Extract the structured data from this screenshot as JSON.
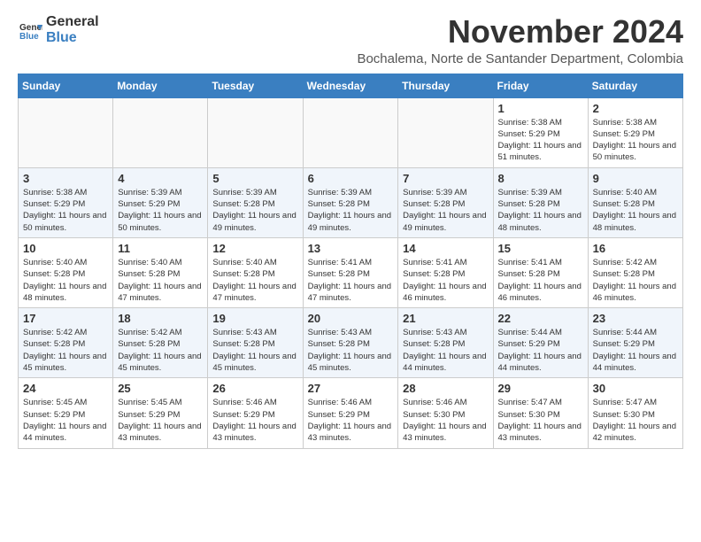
{
  "logo": {
    "general": "General",
    "blue": "Blue"
  },
  "header": {
    "title": "November 2024",
    "subtitle": "Bochalema, Norte de Santander Department, Colombia"
  },
  "columns": [
    "Sunday",
    "Monday",
    "Tuesday",
    "Wednesday",
    "Thursday",
    "Friday",
    "Saturday"
  ],
  "weeks": [
    [
      {
        "day": "",
        "info": ""
      },
      {
        "day": "",
        "info": ""
      },
      {
        "day": "",
        "info": ""
      },
      {
        "day": "",
        "info": ""
      },
      {
        "day": "",
        "info": ""
      },
      {
        "day": "1",
        "info": "Sunrise: 5:38 AM\nSunset: 5:29 PM\nDaylight: 11 hours and 51 minutes."
      },
      {
        "day": "2",
        "info": "Sunrise: 5:38 AM\nSunset: 5:29 PM\nDaylight: 11 hours and 50 minutes."
      }
    ],
    [
      {
        "day": "3",
        "info": "Sunrise: 5:38 AM\nSunset: 5:29 PM\nDaylight: 11 hours and 50 minutes."
      },
      {
        "day": "4",
        "info": "Sunrise: 5:39 AM\nSunset: 5:29 PM\nDaylight: 11 hours and 50 minutes."
      },
      {
        "day": "5",
        "info": "Sunrise: 5:39 AM\nSunset: 5:28 PM\nDaylight: 11 hours and 49 minutes."
      },
      {
        "day": "6",
        "info": "Sunrise: 5:39 AM\nSunset: 5:28 PM\nDaylight: 11 hours and 49 minutes."
      },
      {
        "day": "7",
        "info": "Sunrise: 5:39 AM\nSunset: 5:28 PM\nDaylight: 11 hours and 49 minutes."
      },
      {
        "day": "8",
        "info": "Sunrise: 5:39 AM\nSunset: 5:28 PM\nDaylight: 11 hours and 48 minutes."
      },
      {
        "day": "9",
        "info": "Sunrise: 5:40 AM\nSunset: 5:28 PM\nDaylight: 11 hours and 48 minutes."
      }
    ],
    [
      {
        "day": "10",
        "info": "Sunrise: 5:40 AM\nSunset: 5:28 PM\nDaylight: 11 hours and 48 minutes."
      },
      {
        "day": "11",
        "info": "Sunrise: 5:40 AM\nSunset: 5:28 PM\nDaylight: 11 hours and 47 minutes."
      },
      {
        "day": "12",
        "info": "Sunrise: 5:40 AM\nSunset: 5:28 PM\nDaylight: 11 hours and 47 minutes."
      },
      {
        "day": "13",
        "info": "Sunrise: 5:41 AM\nSunset: 5:28 PM\nDaylight: 11 hours and 47 minutes."
      },
      {
        "day": "14",
        "info": "Sunrise: 5:41 AM\nSunset: 5:28 PM\nDaylight: 11 hours and 46 minutes."
      },
      {
        "day": "15",
        "info": "Sunrise: 5:41 AM\nSunset: 5:28 PM\nDaylight: 11 hours and 46 minutes."
      },
      {
        "day": "16",
        "info": "Sunrise: 5:42 AM\nSunset: 5:28 PM\nDaylight: 11 hours and 46 minutes."
      }
    ],
    [
      {
        "day": "17",
        "info": "Sunrise: 5:42 AM\nSunset: 5:28 PM\nDaylight: 11 hours and 45 minutes."
      },
      {
        "day": "18",
        "info": "Sunrise: 5:42 AM\nSunset: 5:28 PM\nDaylight: 11 hours and 45 minutes."
      },
      {
        "day": "19",
        "info": "Sunrise: 5:43 AM\nSunset: 5:28 PM\nDaylight: 11 hours and 45 minutes."
      },
      {
        "day": "20",
        "info": "Sunrise: 5:43 AM\nSunset: 5:28 PM\nDaylight: 11 hours and 45 minutes."
      },
      {
        "day": "21",
        "info": "Sunrise: 5:43 AM\nSunset: 5:28 PM\nDaylight: 11 hours and 44 minutes."
      },
      {
        "day": "22",
        "info": "Sunrise: 5:44 AM\nSunset: 5:29 PM\nDaylight: 11 hours and 44 minutes."
      },
      {
        "day": "23",
        "info": "Sunrise: 5:44 AM\nSunset: 5:29 PM\nDaylight: 11 hours and 44 minutes."
      }
    ],
    [
      {
        "day": "24",
        "info": "Sunrise: 5:45 AM\nSunset: 5:29 PM\nDaylight: 11 hours and 44 minutes."
      },
      {
        "day": "25",
        "info": "Sunrise: 5:45 AM\nSunset: 5:29 PM\nDaylight: 11 hours and 43 minutes."
      },
      {
        "day": "26",
        "info": "Sunrise: 5:46 AM\nSunset: 5:29 PM\nDaylight: 11 hours and 43 minutes."
      },
      {
        "day": "27",
        "info": "Sunrise: 5:46 AM\nSunset: 5:29 PM\nDaylight: 11 hours and 43 minutes."
      },
      {
        "day": "28",
        "info": "Sunrise: 5:46 AM\nSunset: 5:30 PM\nDaylight: 11 hours and 43 minutes."
      },
      {
        "day": "29",
        "info": "Sunrise: 5:47 AM\nSunset: 5:30 PM\nDaylight: 11 hours and 43 minutes."
      },
      {
        "day": "30",
        "info": "Sunrise: 5:47 AM\nSunset: 5:30 PM\nDaylight: 11 hours and 42 minutes."
      }
    ]
  ]
}
